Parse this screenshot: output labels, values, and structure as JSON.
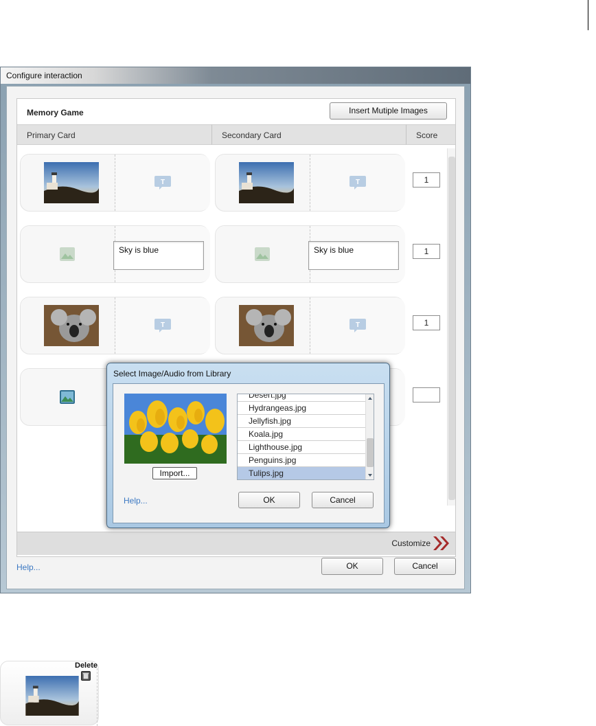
{
  "dialog": {
    "title": "Configure interaction",
    "panel_title": "Memory Game",
    "insert_button": "Insert Mutiple Images",
    "columns": {
      "primary": "Primary Card",
      "secondary": "Secondary Card",
      "score": "Score"
    },
    "rows": [
      {
        "primary": {
          "kind": "image",
          "image": "lighthouse"
        },
        "primary_text": "",
        "secondary": {
          "kind": "image",
          "image": "lighthouse"
        },
        "secondary_text": "",
        "score": "1"
      },
      {
        "primary": {
          "kind": "placeholder"
        },
        "primary_text": "Sky is blue",
        "secondary": {
          "kind": "placeholder"
        },
        "secondary_text": "Sky is blue",
        "score": "1"
      },
      {
        "primary": {
          "kind": "image",
          "image": "koala"
        },
        "primary_text": "",
        "secondary": {
          "kind": "image",
          "image": "koala"
        },
        "secondary_text": "",
        "score": "1"
      },
      {
        "primary": {
          "kind": "placeholder-active"
        },
        "primary_text": "",
        "score": ""
      }
    ],
    "customize_label": "Customize",
    "help_link": "Help...",
    "ok_button": "OK",
    "cancel_button": "Cancel",
    "colors": {
      "accent_red": "#a52a2a",
      "link_blue": "#3b78c2"
    }
  },
  "library_modal": {
    "title": "Select Image/Audio from Library",
    "import_button": "Import...",
    "files": [
      "Desert.jpg",
      "Hydrangeas.jpg",
      "Jellyfish.jpg",
      "Koala.jpg",
      "Lighthouse.jpg",
      "Penguins.jpg",
      "Tulips.jpg"
    ],
    "selected_file": "Tulips.jpg",
    "help_link": "Help...",
    "ok_button": "OK",
    "cancel_button": "Cancel"
  },
  "card_detail": {
    "delete_label": "Delete"
  }
}
